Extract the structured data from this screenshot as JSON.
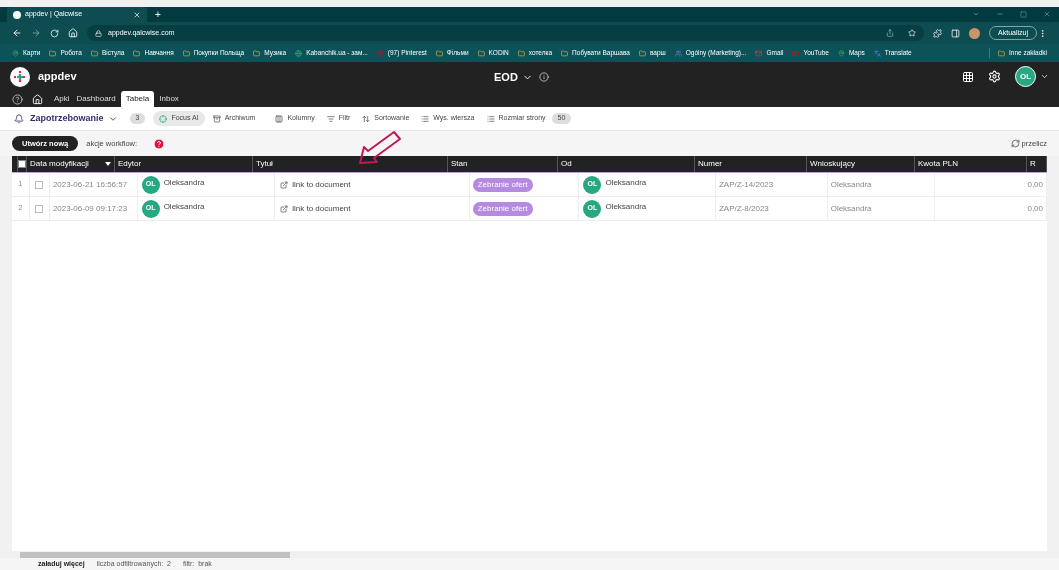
{
  "browser": {
    "tab_title": "appdev | Qalcwise",
    "new_tab": "+",
    "url": "appdev.qalcwise.com",
    "update_button": "Aktualizuj",
    "bookmarks": [
      {
        "label": "Карти",
        "kind": "map"
      },
      {
        "label": "Робота",
        "kind": "folder"
      },
      {
        "label": "Вістула",
        "kind": "folder"
      },
      {
        "label": "Навчання",
        "kind": "folder"
      },
      {
        "label": "Покупки Польща",
        "kind": "folder"
      },
      {
        "label": "Музика",
        "kind": "folder"
      },
      {
        "label": "Kabanchik.ua - зам...",
        "kind": "site"
      },
      {
        "label": "(97) Pinterest",
        "kind": "pin"
      },
      {
        "label": "Фільми",
        "kind": "folder"
      },
      {
        "label": "KODiN",
        "kind": "folder"
      },
      {
        "label": "хотелка",
        "kind": "folder"
      },
      {
        "label": "Побувати Варшава",
        "kind": "folder"
      },
      {
        "label": "варш",
        "kind": "folder"
      },
      {
        "label": "Ogólny (Marketing)...",
        "kind": "teams"
      },
      {
        "label": "Gmail",
        "kind": "mail"
      },
      {
        "label": "YouTube",
        "kind": "video"
      },
      {
        "label": "Maps",
        "kind": "map"
      },
      {
        "label": "Translate",
        "kind": "translate"
      }
    ],
    "other_bookmarks": "Inne zakładki"
  },
  "app": {
    "name": "appdev",
    "module": "EOD",
    "avatar": "OL",
    "nav": [
      {
        "label": "Apki",
        "selected": false
      },
      {
        "label": "Dashboard",
        "selected": false
      },
      {
        "label": "Tabela",
        "selected": true
      },
      {
        "label": "Inbox",
        "selected": false
      }
    ]
  },
  "toolbar": {
    "view": "Zapotrzebowanie",
    "count": "3",
    "focus": "Focus AI",
    "archive": "Archiwum",
    "columns": "Kolumny",
    "filter": "Filtr",
    "sort": "Sortowanie",
    "row_height": "Wys. wiersza",
    "page_size": "Rozmiar strony",
    "page_size_value": "50"
  },
  "actions": {
    "create": "Utwórz nową",
    "workflow": "akcje workflow:",
    "recalc": "przelicz"
  },
  "table": {
    "all_checked": false,
    "columns": [
      "Data modyfikacji",
      "Edytor",
      "Tytuł",
      "Stan",
      "Od",
      "Numer",
      "Wnioskujący",
      "Kwota PLN",
      "R"
    ],
    "rows": [
      {
        "index": "1",
        "checked": false,
        "date": "2023-06-21 16:56:57",
        "editor_avatar": "OL",
        "editor": "Oleksandra",
        "title": "link to document",
        "status": "Zebranie ofert",
        "from_avatar": "OL",
        "from": "Oleksandra",
        "number": "ZAP/Z-14/2023",
        "requester": "Oleksandra",
        "amount": "0,00"
      },
      {
        "index": "2",
        "checked": false,
        "date": "2023-06-09 09:17:23",
        "editor_avatar": "OL",
        "editor": "Oleksandra",
        "title": "link to document",
        "status": "Zebranie ofert",
        "from_avatar": "OL",
        "from": "Oleksandra",
        "number": "ZAP/Z-8/2023",
        "requester": "Oleksandra",
        "amount": "0,00"
      }
    ]
  },
  "footer": {
    "load_more": "załaduj więcej",
    "filtered": "liczba odfiltrowanych:  2",
    "filter": "filtr:  brak"
  }
}
